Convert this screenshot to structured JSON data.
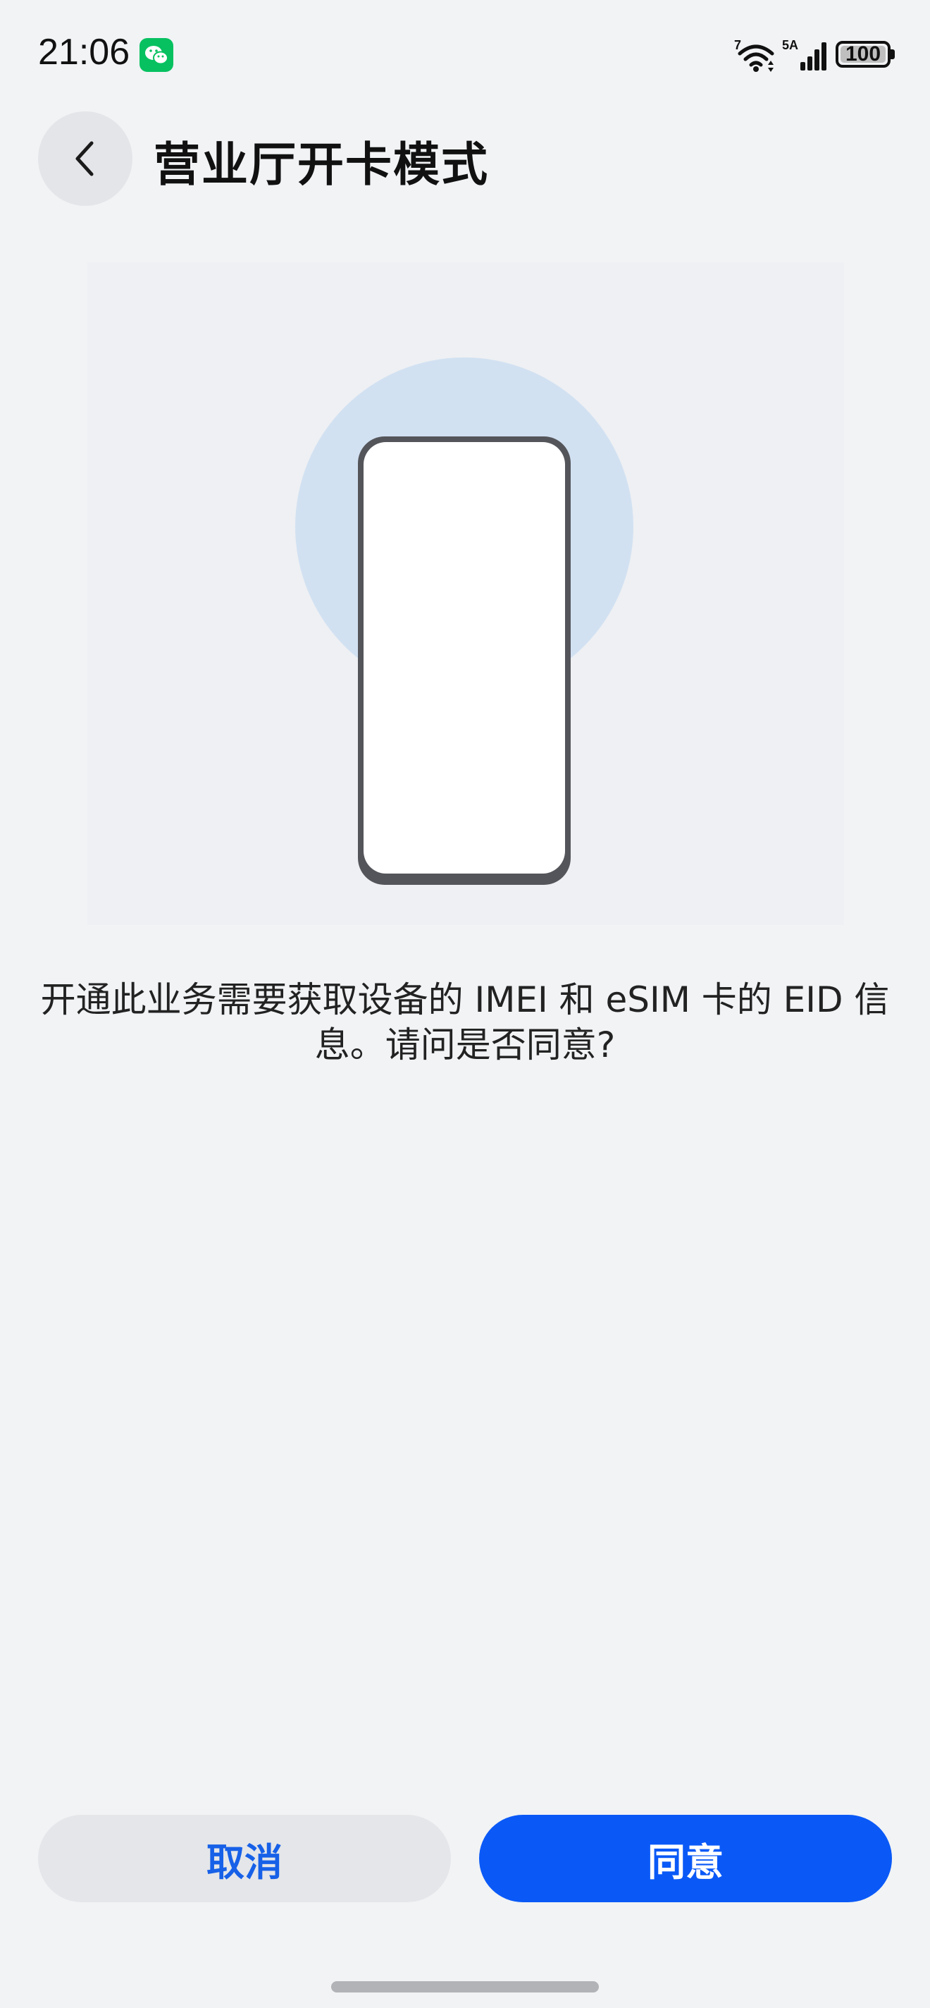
{
  "status_bar": {
    "time": "21:06",
    "battery": "100",
    "wifi_badge": "7",
    "signal_badge": "5A",
    "notification_icon": "wechat-icon"
  },
  "header": {
    "back_icon": "chevron-left-icon",
    "title": "营业厅开卡模式"
  },
  "illustration": {
    "icon": "phone-illustration",
    "circle_color": "#d2e1f2",
    "phone_frame_color": "#54555a"
  },
  "message": {
    "text": "开通此业务需要获取设备的 IMEI 和 eSIM 卡的 EID 信息。请问是否同意?"
  },
  "actions": {
    "cancel_label": "取消",
    "agree_label": "同意",
    "accent_color": "#0a59f7"
  }
}
